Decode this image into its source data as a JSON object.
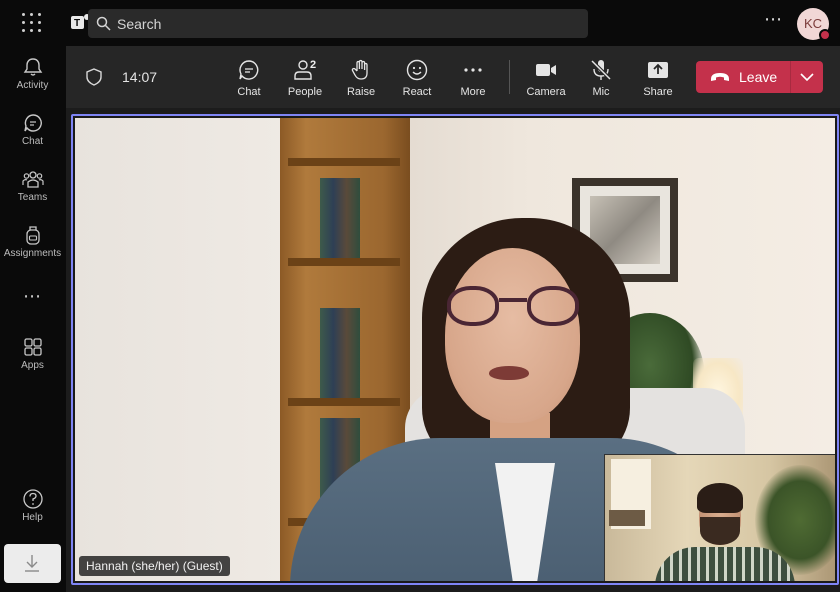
{
  "topbar": {
    "search_placeholder": "Search",
    "more_label": "⋯",
    "avatar_initials": "KC",
    "status_color": "#c4314b"
  },
  "rail": {
    "items": [
      {
        "label": "Activity",
        "icon": "bell-icon"
      },
      {
        "label": "Chat",
        "icon": "chat-icon"
      },
      {
        "label": "Teams",
        "icon": "teams-icon"
      },
      {
        "label": "Assignments",
        "icon": "backpack-icon"
      },
      {
        "label": "Apps",
        "icon": "apps-icon"
      },
      {
        "label": "Help",
        "icon": "help-icon"
      }
    ],
    "more_label": "⋯"
  },
  "toolbar": {
    "time": "14:07",
    "buttons": [
      {
        "label": "Chat",
        "icon": "chat-icon"
      },
      {
        "label": "People",
        "icon": "person-icon",
        "count": "2"
      },
      {
        "label": "Raise",
        "icon": "hand-icon"
      },
      {
        "label": "React",
        "icon": "smile-icon"
      },
      {
        "label": "More",
        "icon": "more-icon"
      },
      {
        "label": "Camera",
        "icon": "camera-icon"
      },
      {
        "label": "Mic",
        "icon": "mic-off-icon"
      },
      {
        "label": "Share",
        "icon": "share-icon"
      }
    ],
    "leave_label": "Leave",
    "leave_color": "#c4314b"
  },
  "stage": {
    "participant_name": "Hannah (she/her) (Guest)",
    "active_speaker_color": "#7f85f5"
  }
}
